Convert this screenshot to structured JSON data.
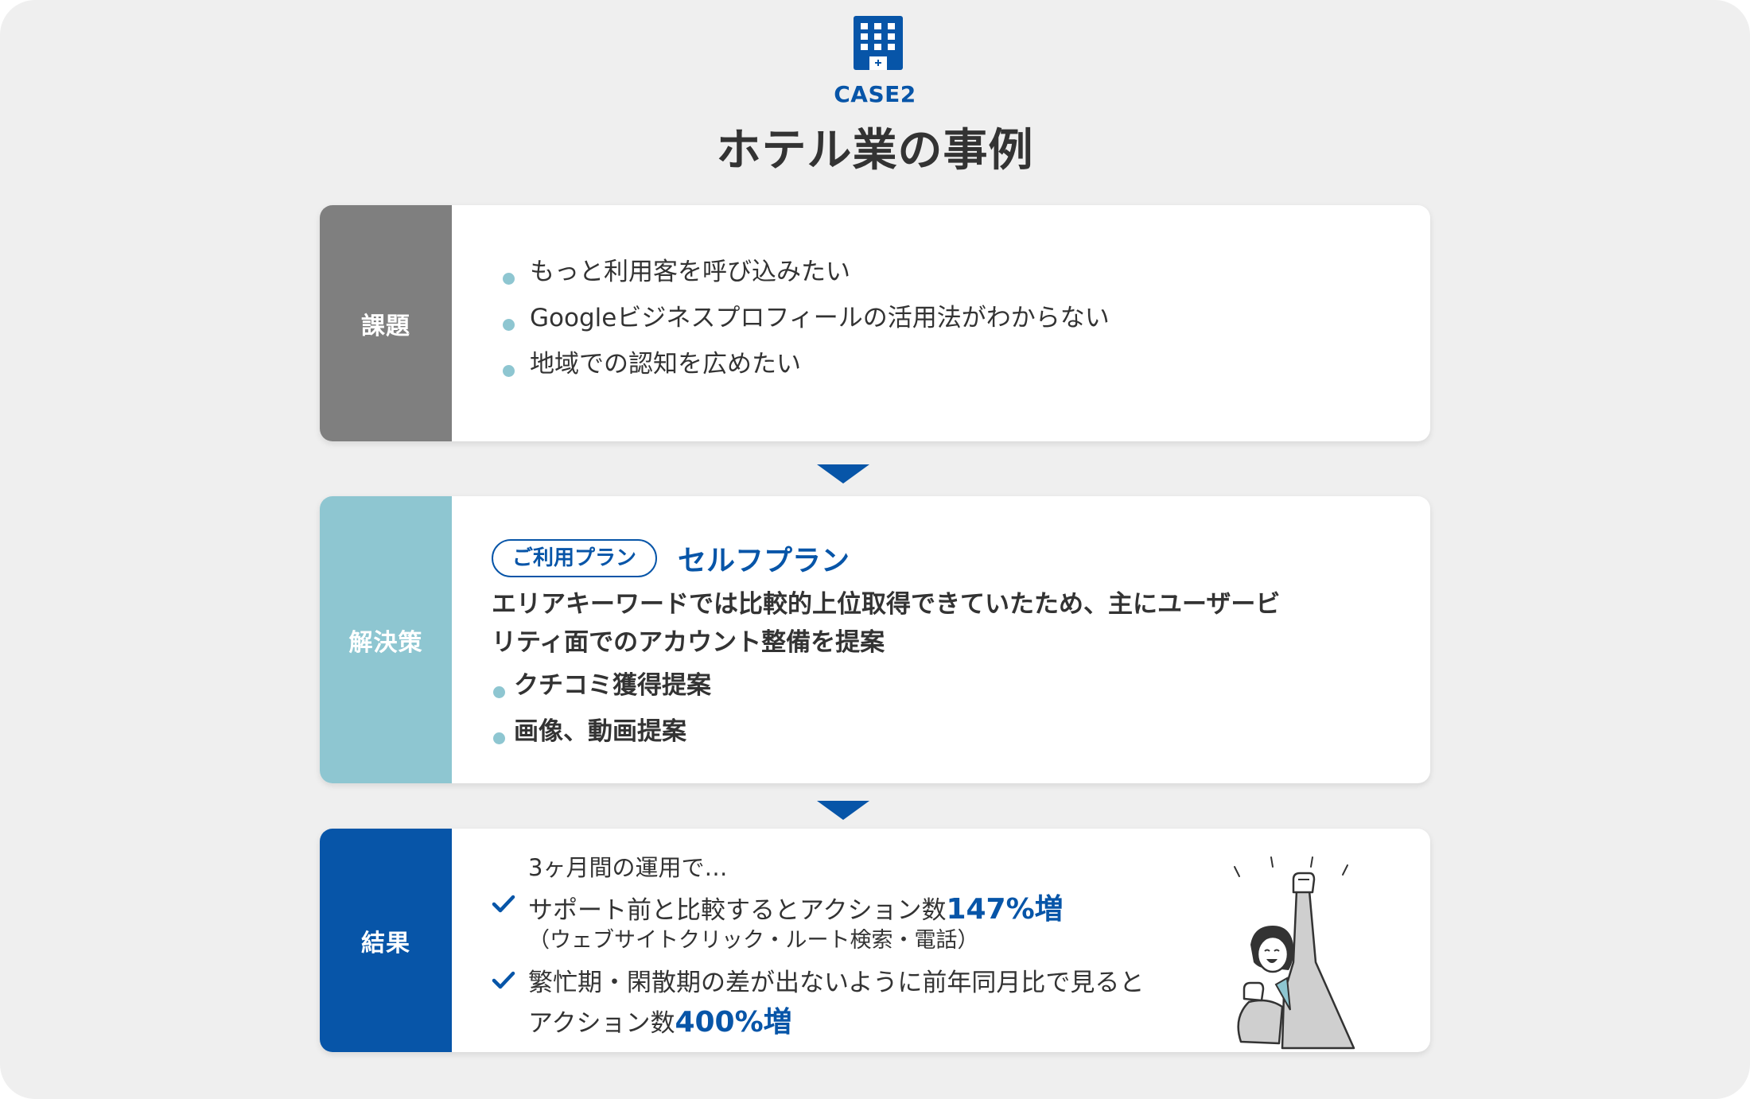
{
  "header": {
    "icon": "building-icon",
    "case_label": "CASE2",
    "title": "ホテル業の事例"
  },
  "colors": {
    "background": "#efefef",
    "brand_blue": "#0755a8",
    "issue_gray": "#7f7f7f",
    "solution_teal": "#8ec6d1",
    "text": "#333333"
  },
  "issue": {
    "label": "課題",
    "items": [
      "もっと利用客を呼び込みたい",
      "Googleビジネスプロフィールの活用法がわからない",
      "地域での認知を広めたい"
    ]
  },
  "solution": {
    "label": "解決策",
    "plan_tag": "ご利用プラン",
    "plan_name": "セルフプラン",
    "description_lines": [
      "エリアキーワードでは比較的上位取得できていたため、主にユーザービ",
      "リティ面でのアカウント整備を提案"
    ],
    "items": [
      "クチコミ獲得提案",
      "画像、動画提案"
    ]
  },
  "result": {
    "label": "結果",
    "intro": "3ヶ月間の運用で…",
    "item1": {
      "prefix": "サポート前と比較するとアクション数",
      "highlight": "147%増",
      "note": "（ウェブサイトクリック・ルート検索・電話）"
    },
    "item2": {
      "line1": "繁忙期・閑散期の差が出ないように前年同月比で見ると",
      "prefix": "アクション数",
      "highlight": "400%増"
    },
    "illustration": "cheering-person-illustration"
  }
}
